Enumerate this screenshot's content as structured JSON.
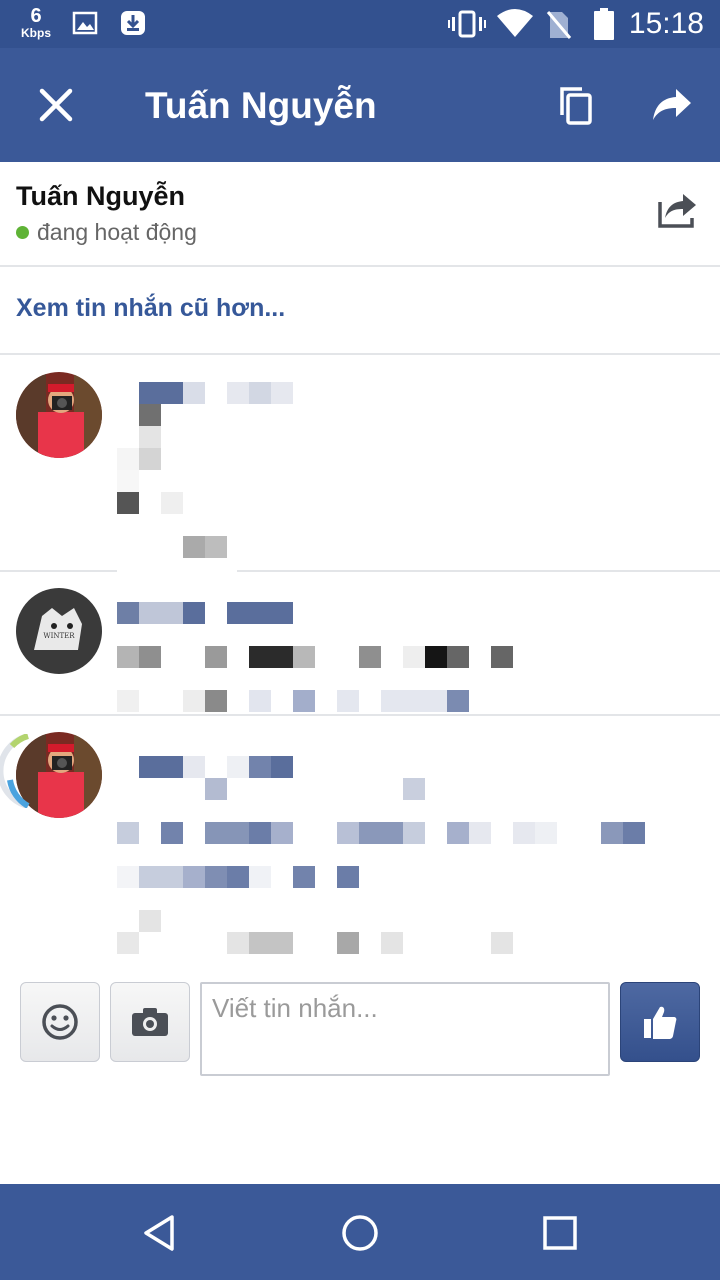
{
  "status_bar": {
    "speed_value": "6",
    "speed_unit": "Kbps",
    "time": "15:18",
    "icons": [
      "image-icon",
      "download-icon",
      "vibrate-icon",
      "wifi-icon",
      "no-sim-icon",
      "battery-icon"
    ]
  },
  "app_bar": {
    "title": "Tuấn Nguyễn",
    "icons": [
      "close-icon",
      "copy-icon",
      "forward-icon"
    ]
  },
  "conversation": {
    "name": "Tuấn Nguyễn",
    "presence": "đang hoạt động",
    "presence_color": "#5fb336",
    "older_link": "Xem tin nhắn cũ hơn..."
  },
  "composer": {
    "placeholder": "Viết tin nhắn...",
    "icons": [
      "emoji-icon",
      "camera-icon",
      "thumbs-up-icon"
    ]
  },
  "nav_bar": {
    "icons": [
      "back-icon",
      "home-icon",
      "recents-icon"
    ]
  },
  "colors": {
    "brand": "#3b5998",
    "status_bar": "#33518f",
    "link": "#365899"
  }
}
